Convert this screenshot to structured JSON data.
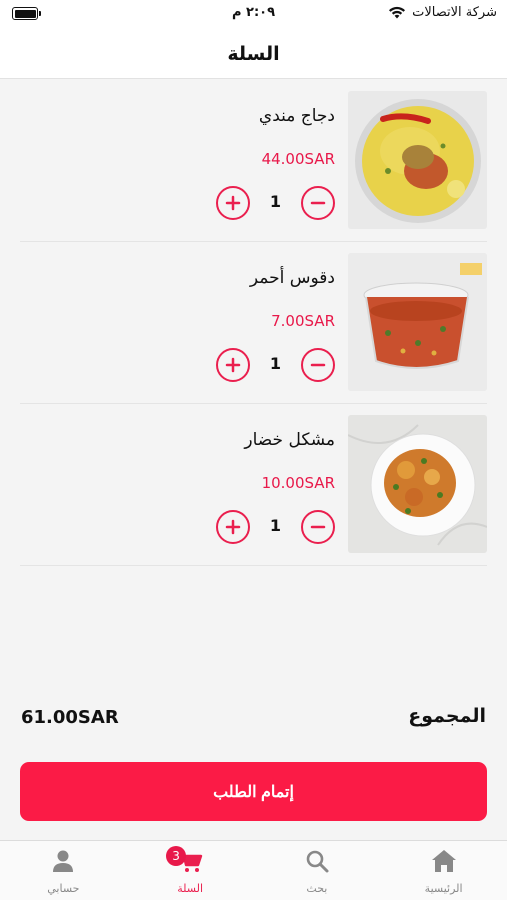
{
  "status_bar": {
    "carrier": "شركة الاتصالات",
    "time": "٢:٠٩ م"
  },
  "header": {
    "title": "السلة"
  },
  "cart": {
    "items": [
      {
        "name": "دجاج مندي",
        "price": "44.00SAR",
        "quantity": "1",
        "image": "chicken-mandi-photo"
      },
      {
        "name": "دقوس أحمر",
        "price": "7.00SAR",
        "quantity": "1",
        "image": "red-daqoos-sauce-photo"
      },
      {
        "name": "مشكل خضار",
        "price": "10.00SAR",
        "quantity": "1",
        "image": "mixed-vegetables-photo"
      }
    ]
  },
  "summary": {
    "total_label": "المجموع",
    "total_value": "61.00SAR"
  },
  "checkout": {
    "label": "إتمام الطلب"
  },
  "tab_bar": {
    "tabs": [
      {
        "label": "الرئيسية",
        "icon": "home-icon",
        "active": false
      },
      {
        "label": "بحث",
        "icon": "search-icon",
        "active": false
      },
      {
        "label": "السلة",
        "icon": "cart-icon",
        "active": true,
        "badge": "3"
      },
      {
        "label": "حسابي",
        "icon": "user-icon",
        "active": false
      }
    ]
  },
  "colors": {
    "accent": "#fb1b46",
    "price": "#e8194a",
    "inactive_tab": "#888888"
  }
}
